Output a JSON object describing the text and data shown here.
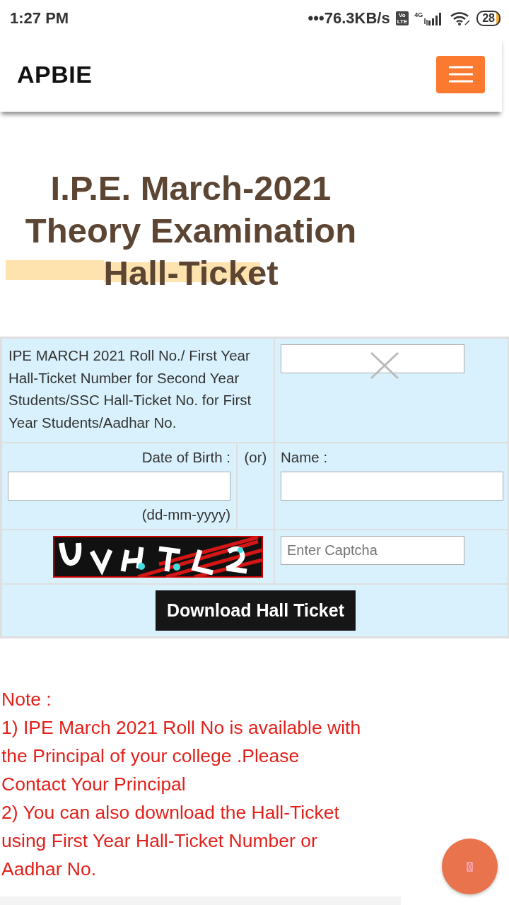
{
  "status_bar": {
    "time": "1:27 PM",
    "speed": "•••76.3KB/s",
    "volte": [
      "Vo",
      "LTE"
    ],
    "network": "4G",
    "battery": "28"
  },
  "header": {
    "brand": "APBIE"
  },
  "heading": {
    "lines": [
      "I.P.E. March-2021",
      "Theory Examination",
      "Hall-Ticket"
    ]
  },
  "form": {
    "roll_label": "IPE MARCH 2021 Roll No./ First Year Hall-Ticket Number for Second Year Students/SSC Hall-Ticket No. for First Year Students/Aadhar No.",
    "dob_label": "Date of Birth :",
    "or": "(or)",
    "name_label": "Name :",
    "dob_hint": "(dd-mm-yyyy)",
    "captcha_field": {
      "placeholder": "Enter Captcha"
    },
    "submit": "Download Hall Ticket"
  },
  "note": {
    "title": "Note :",
    "items": [
      "1) IPE March 2021 Roll No is available with the Principal of your college .Please Contact Your Principal",
      "2) You can also download the Hall-Ticket using First Year Hall-Ticket Number or Aadhar No."
    ]
  }
}
